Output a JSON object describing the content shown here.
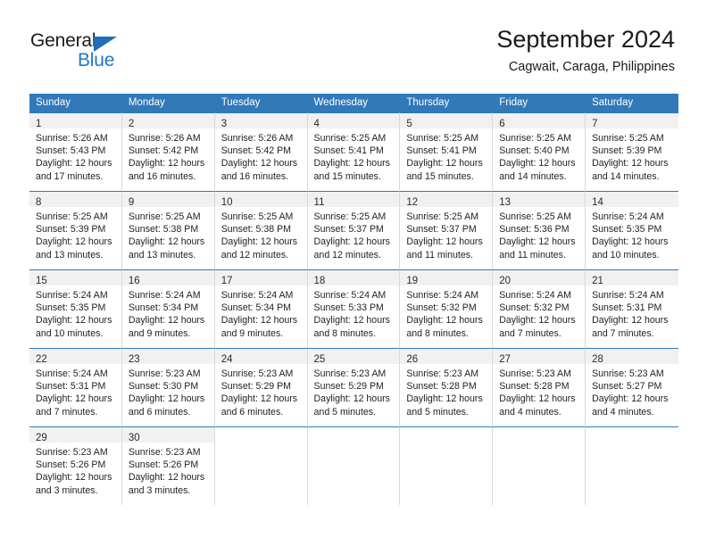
{
  "brand": {
    "name_top": "General",
    "name_bottom": "Blue",
    "accent_color": "#2079c8",
    "triangle_color": "#1f6fb7"
  },
  "header": {
    "month_title": "September 2024",
    "location": "Cagwait, Caraga, Philippines"
  },
  "calendar": {
    "header_background": "#3179b9",
    "daynum_background": "#f1f1f1",
    "weekdays": [
      "Sunday",
      "Monday",
      "Tuesday",
      "Wednesday",
      "Thursday",
      "Friday",
      "Saturday"
    ],
    "weeks": [
      [
        {
          "day": "1",
          "sunrise": "Sunrise: 5:26 AM",
          "sunset": "Sunset: 5:43 PM",
          "daylight_line1": "Daylight: 12 hours",
          "daylight_line2": "and 17 minutes."
        },
        {
          "day": "2",
          "sunrise": "Sunrise: 5:26 AM",
          "sunset": "Sunset: 5:42 PM",
          "daylight_line1": "Daylight: 12 hours",
          "daylight_line2": "and 16 minutes."
        },
        {
          "day": "3",
          "sunrise": "Sunrise: 5:26 AM",
          "sunset": "Sunset: 5:42 PM",
          "daylight_line1": "Daylight: 12 hours",
          "daylight_line2": "and 16 minutes."
        },
        {
          "day": "4",
          "sunrise": "Sunrise: 5:25 AM",
          "sunset": "Sunset: 5:41 PM",
          "daylight_line1": "Daylight: 12 hours",
          "daylight_line2": "and 15 minutes."
        },
        {
          "day": "5",
          "sunrise": "Sunrise: 5:25 AM",
          "sunset": "Sunset: 5:41 PM",
          "daylight_line1": "Daylight: 12 hours",
          "daylight_line2": "and 15 minutes."
        },
        {
          "day": "6",
          "sunrise": "Sunrise: 5:25 AM",
          "sunset": "Sunset: 5:40 PM",
          "daylight_line1": "Daylight: 12 hours",
          "daylight_line2": "and 14 minutes."
        },
        {
          "day": "7",
          "sunrise": "Sunrise: 5:25 AM",
          "sunset": "Sunset: 5:39 PM",
          "daylight_line1": "Daylight: 12 hours",
          "daylight_line2": "and 14 minutes."
        }
      ],
      [
        {
          "day": "8",
          "sunrise": "Sunrise: 5:25 AM",
          "sunset": "Sunset: 5:39 PM",
          "daylight_line1": "Daylight: 12 hours",
          "daylight_line2": "and 13 minutes."
        },
        {
          "day": "9",
          "sunrise": "Sunrise: 5:25 AM",
          "sunset": "Sunset: 5:38 PM",
          "daylight_line1": "Daylight: 12 hours",
          "daylight_line2": "and 13 minutes."
        },
        {
          "day": "10",
          "sunrise": "Sunrise: 5:25 AM",
          "sunset": "Sunset: 5:38 PM",
          "daylight_line1": "Daylight: 12 hours",
          "daylight_line2": "and 12 minutes."
        },
        {
          "day": "11",
          "sunrise": "Sunrise: 5:25 AM",
          "sunset": "Sunset: 5:37 PM",
          "daylight_line1": "Daylight: 12 hours",
          "daylight_line2": "and 12 minutes."
        },
        {
          "day": "12",
          "sunrise": "Sunrise: 5:25 AM",
          "sunset": "Sunset: 5:37 PM",
          "daylight_line1": "Daylight: 12 hours",
          "daylight_line2": "and 11 minutes."
        },
        {
          "day": "13",
          "sunrise": "Sunrise: 5:25 AM",
          "sunset": "Sunset: 5:36 PM",
          "daylight_line1": "Daylight: 12 hours",
          "daylight_line2": "and 11 minutes."
        },
        {
          "day": "14",
          "sunrise": "Sunrise: 5:24 AM",
          "sunset": "Sunset: 5:35 PM",
          "daylight_line1": "Daylight: 12 hours",
          "daylight_line2": "and 10 minutes."
        }
      ],
      [
        {
          "day": "15",
          "sunrise": "Sunrise: 5:24 AM",
          "sunset": "Sunset: 5:35 PM",
          "daylight_line1": "Daylight: 12 hours",
          "daylight_line2": "and 10 minutes."
        },
        {
          "day": "16",
          "sunrise": "Sunrise: 5:24 AM",
          "sunset": "Sunset: 5:34 PM",
          "daylight_line1": "Daylight: 12 hours",
          "daylight_line2": "and 9 minutes."
        },
        {
          "day": "17",
          "sunrise": "Sunrise: 5:24 AM",
          "sunset": "Sunset: 5:34 PM",
          "daylight_line1": "Daylight: 12 hours",
          "daylight_line2": "and 9 minutes."
        },
        {
          "day": "18",
          "sunrise": "Sunrise: 5:24 AM",
          "sunset": "Sunset: 5:33 PM",
          "daylight_line1": "Daylight: 12 hours",
          "daylight_line2": "and 8 minutes."
        },
        {
          "day": "19",
          "sunrise": "Sunrise: 5:24 AM",
          "sunset": "Sunset: 5:32 PM",
          "daylight_line1": "Daylight: 12 hours",
          "daylight_line2": "and 8 minutes."
        },
        {
          "day": "20",
          "sunrise": "Sunrise: 5:24 AM",
          "sunset": "Sunset: 5:32 PM",
          "daylight_line1": "Daylight: 12 hours",
          "daylight_line2": "and 7 minutes."
        },
        {
          "day": "21",
          "sunrise": "Sunrise: 5:24 AM",
          "sunset": "Sunset: 5:31 PM",
          "daylight_line1": "Daylight: 12 hours",
          "daylight_line2": "and 7 minutes."
        }
      ],
      [
        {
          "day": "22",
          "sunrise": "Sunrise: 5:24 AM",
          "sunset": "Sunset: 5:31 PM",
          "daylight_line1": "Daylight: 12 hours",
          "daylight_line2": "and 7 minutes."
        },
        {
          "day": "23",
          "sunrise": "Sunrise: 5:23 AM",
          "sunset": "Sunset: 5:30 PM",
          "daylight_line1": "Daylight: 12 hours",
          "daylight_line2": "and 6 minutes."
        },
        {
          "day": "24",
          "sunrise": "Sunrise: 5:23 AM",
          "sunset": "Sunset: 5:29 PM",
          "daylight_line1": "Daylight: 12 hours",
          "daylight_line2": "and 6 minutes."
        },
        {
          "day": "25",
          "sunrise": "Sunrise: 5:23 AM",
          "sunset": "Sunset: 5:29 PM",
          "daylight_line1": "Daylight: 12 hours",
          "daylight_line2": "and 5 minutes."
        },
        {
          "day": "26",
          "sunrise": "Sunrise: 5:23 AM",
          "sunset": "Sunset: 5:28 PM",
          "daylight_line1": "Daylight: 12 hours",
          "daylight_line2": "and 5 minutes."
        },
        {
          "day": "27",
          "sunrise": "Sunrise: 5:23 AM",
          "sunset": "Sunset: 5:28 PM",
          "daylight_line1": "Daylight: 12 hours",
          "daylight_line2": "and 4 minutes."
        },
        {
          "day": "28",
          "sunrise": "Sunrise: 5:23 AM",
          "sunset": "Sunset: 5:27 PM",
          "daylight_line1": "Daylight: 12 hours",
          "daylight_line2": "and 4 minutes."
        }
      ],
      [
        {
          "day": "29",
          "sunrise": "Sunrise: 5:23 AM",
          "sunset": "Sunset: 5:26 PM",
          "daylight_line1": "Daylight: 12 hours",
          "daylight_line2": "and 3 minutes."
        },
        {
          "day": "30",
          "sunrise": "Sunrise: 5:23 AM",
          "sunset": "Sunset: 5:26 PM",
          "daylight_line1": "Daylight: 12 hours",
          "daylight_line2": "and 3 minutes."
        },
        {
          "day": "",
          "sunrise": "",
          "sunset": "",
          "daylight_line1": "",
          "daylight_line2": ""
        },
        {
          "day": "",
          "sunrise": "",
          "sunset": "",
          "daylight_line1": "",
          "daylight_line2": ""
        },
        {
          "day": "",
          "sunrise": "",
          "sunset": "",
          "daylight_line1": "",
          "daylight_line2": ""
        },
        {
          "day": "",
          "sunrise": "",
          "sunset": "",
          "daylight_line1": "",
          "daylight_line2": ""
        },
        {
          "day": "",
          "sunrise": "",
          "sunset": "",
          "daylight_line1": "",
          "daylight_line2": ""
        }
      ]
    ]
  }
}
